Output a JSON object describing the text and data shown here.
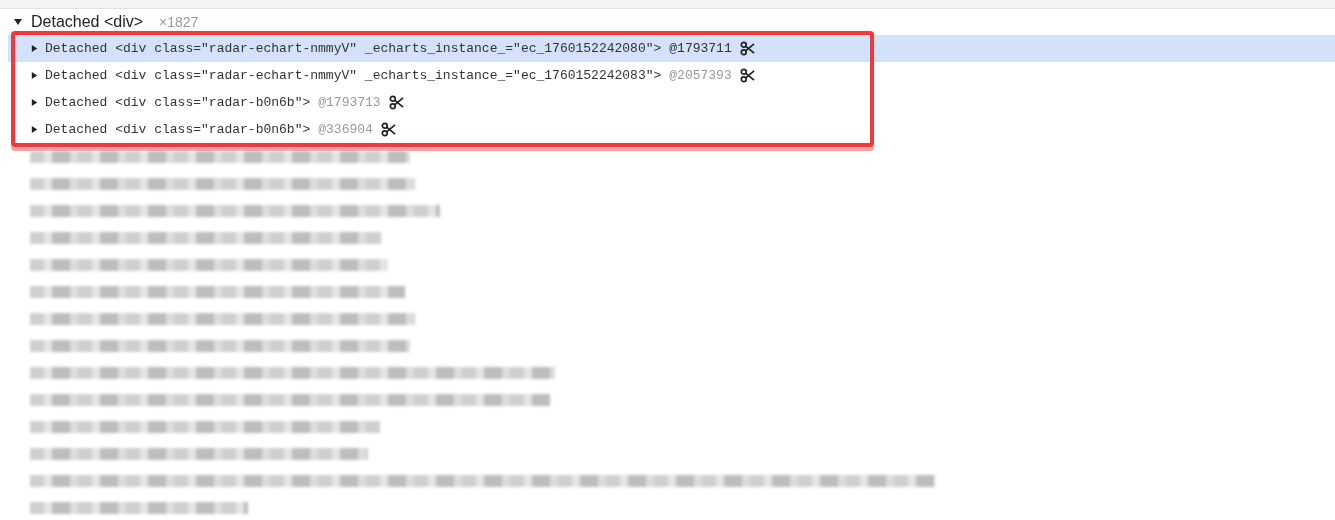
{
  "group": {
    "label": "Detached <div>",
    "count": "×1827",
    "expanded": true
  },
  "rows": [
    {
      "text": "Detached <div class=\"radar-echart-nmmyV\" _echarts_instance_=\"ec_1760152242080\">",
      "id": "@1793711",
      "selected": true,
      "expanded": false
    },
    {
      "text": "Detached <div class=\"radar-echart-nmmyV\" _echarts_instance_=\"ec_1760152242083\">",
      "id": "@2057393",
      "selected": false,
      "expanded": false
    },
    {
      "text": "Detached <div class=\"radar-b0n6b\">",
      "id": "@1793713",
      "selected": false,
      "expanded": false
    },
    {
      "text": "Detached <div class=\"radar-b0n6b\">",
      "id": "@336904",
      "selected": false,
      "expanded": false
    }
  ],
  "annotation": {
    "kind": "box",
    "color": "#f0393b"
  },
  "redacted_rows": [
    {
      "kind": "redacted"
    },
    {
      "kind": "redacted"
    },
    {
      "kind": "redacted"
    },
    {
      "kind": "redacted"
    },
    {
      "kind": "redacted"
    },
    {
      "kind": "redacted"
    },
    {
      "kind": "redacted"
    },
    {
      "kind": "redacted"
    },
    {
      "kind": "redacted"
    },
    {
      "kind": "redacted"
    },
    {
      "kind": "redacted"
    },
    {
      "kind": "redacted"
    },
    {
      "kind": "redacted"
    },
    {
      "kind": "redacted"
    }
  ]
}
